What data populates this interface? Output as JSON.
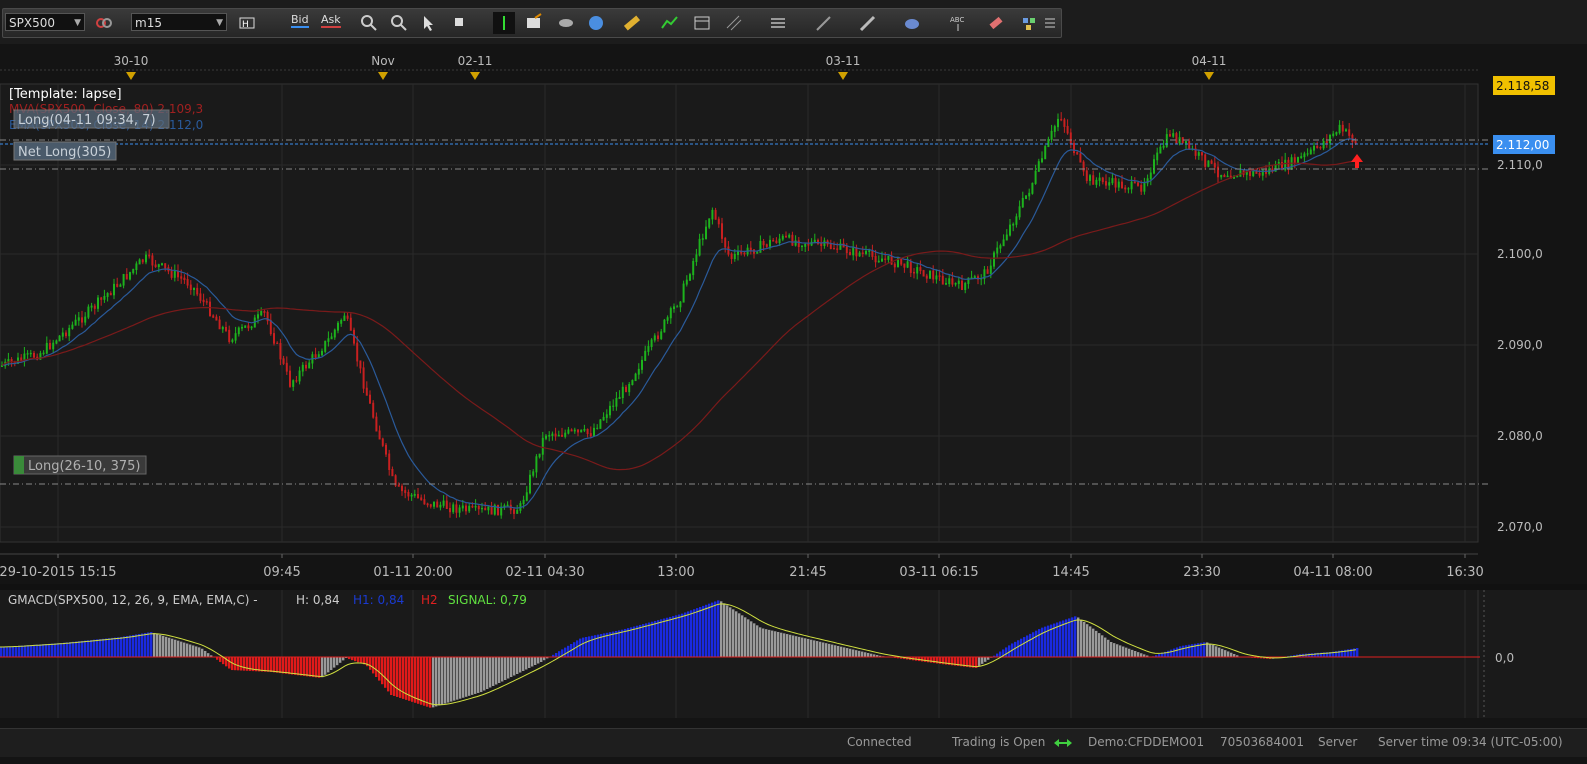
{
  "toolbar": {
    "symbol": "SPX500",
    "timeframe": "m15",
    "bid_label": "Bid",
    "ask_label": "Ask",
    "icons": [
      "link-icon",
      "hi-icon",
      "zoom-in-icon",
      "zoom-out-icon",
      "cursor-icon",
      "pointer-icon",
      "crosshair-icon",
      "note-icon",
      "eye-icon",
      "globe-icon",
      "ruler-icon",
      "chart-icon",
      "window-icon",
      "lines-icon",
      "layers-icon",
      "pen-icon",
      "brush-icon",
      "ellipse-icon",
      "text-icon",
      "eraser-icon",
      "grid-icon",
      "menu-icon"
    ]
  },
  "chart": {
    "template": "[Template: lapse]",
    "ma_legend": "MVA(SPX500, Close, 80) 2.109,3",
    "ema_legend": "EMA(SPX500, Close, 14) 2.112,0",
    "long_top": "Long(04-11 09:34, 7)",
    "net_long": "Net Long(305)",
    "long_bottom": "Long(26-10, 375)",
    "date_markers": [
      "30-10",
      "Nov",
      "02-11",
      "03-11",
      "04-11"
    ],
    "price_labels": [
      "2.110,0",
      "2.100,0",
      "2.090,0",
      "2.080,0",
      "2.070,0"
    ],
    "price_high": "2.118,58",
    "price_current": "2.112,00",
    "time_labels": [
      "29-10-2015 15:15",
      "09:45",
      "01-11 20:00",
      "02-11 04:30",
      "13:00",
      "21:45",
      "03-11 06:15",
      "14:45",
      "23:30",
      "04-11 08:00",
      "16:30"
    ],
    "colors": {
      "up": "#1db31d",
      "down": "#c82020",
      "ema": "#2a5a9a",
      "mva": "#7a1a1a",
      "highlight": "#f0c000",
      "current": "#3a8ff0"
    }
  },
  "macd": {
    "label": "GMACD(SPX500, 12, 26, 9, EMA, EMA,C) -",
    "h_label": "H: 0,84",
    "h1_label": "H1: 0,84",
    "h2_label": "H2",
    "signal_label": "SIGNAL: 0,79",
    "zero_label": "0,0"
  },
  "status": {
    "connected": "Connected",
    "trading": "Trading is Open",
    "account": "Demo:CFDDEMO01",
    "id": "70503684001",
    "server": "Server",
    "server_time": "Server time 09:34 (UTC-05:00)"
  }
}
